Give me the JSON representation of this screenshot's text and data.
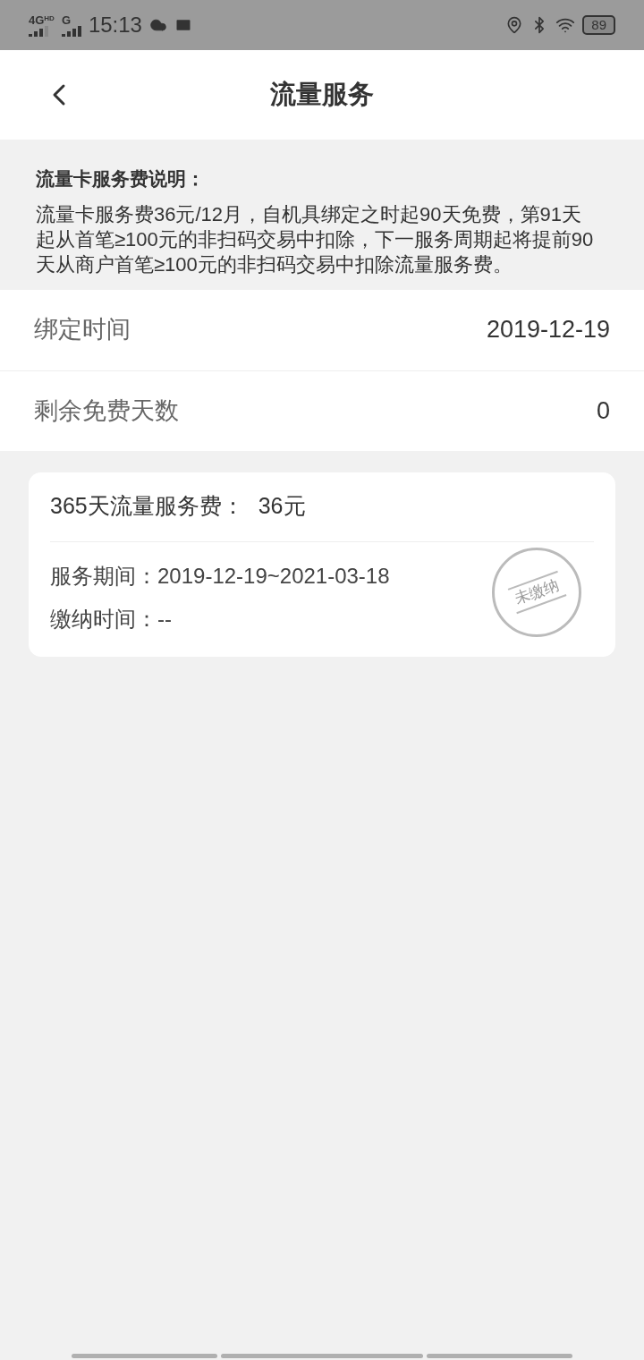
{
  "status_bar": {
    "network_1": "4G",
    "network_1_sup": "HD",
    "network_2": "G",
    "time": "15:13",
    "battery": "89"
  },
  "header": {
    "title": "流量服务"
  },
  "notice": {
    "title": "流量卡服务费说明：",
    "body": "流量卡服务费36元/12月，自机具绑定之时起90天免费，第91天起从首笔≥100元的非扫码交易中扣除，下一服务周期起将提前90天从商户首笔≥100元的非扫码交易中扣除流量服务费。"
  },
  "rows": [
    {
      "label": "绑定时间",
      "value": "2019-12-19"
    },
    {
      "label": "剩余免费天数",
      "value": "0"
    }
  ],
  "fee_card": {
    "title": "365天流量服务费：",
    "amount": "36元",
    "lines": [
      "服务期间：2019-12-19~2021-03-18",
      "缴纳时间：--"
    ],
    "stamp": {
      "text": "未缴纳",
      "paid": false
    }
  }
}
